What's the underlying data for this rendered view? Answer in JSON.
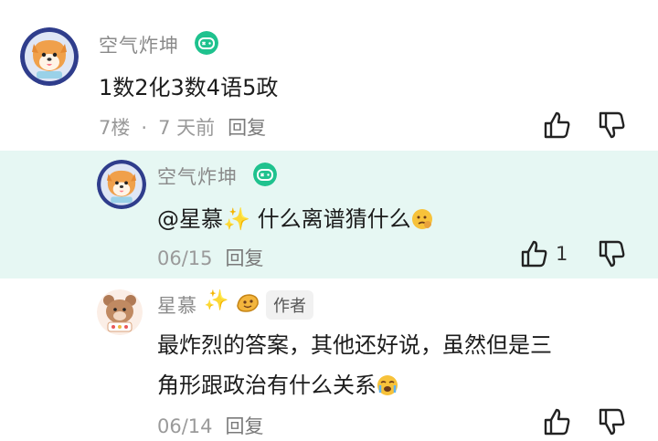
{
  "colors": {
    "reply_highlight_bg": "#e6f7f3",
    "badge_green": "#1fc28e",
    "text_gray": "#8a8a8a"
  },
  "comments": [
    {
      "username": "空气炸坤",
      "badge_icon": "gamepad-icon",
      "text": "1数2化3数4语5政",
      "floor": "7楼",
      "time": "7 天前",
      "reply_label": "回复",
      "likes": ""
    },
    {
      "username": "空气炸坤",
      "badge_icon": "gamepad-icon",
      "mention": "@星慕",
      "text": "  什么离谱猜什么",
      "time": "06/15",
      "reply_label": "回复",
      "likes": "1"
    },
    {
      "username": "星慕",
      "author_badge": "作者",
      "text_line1": "最炸烈的答案，其他还好说，虽然但是三",
      "text_line2": "角形跟政治有什么关系",
      "time": "06/14",
      "reply_label": "回复",
      "likes": ""
    }
  ]
}
